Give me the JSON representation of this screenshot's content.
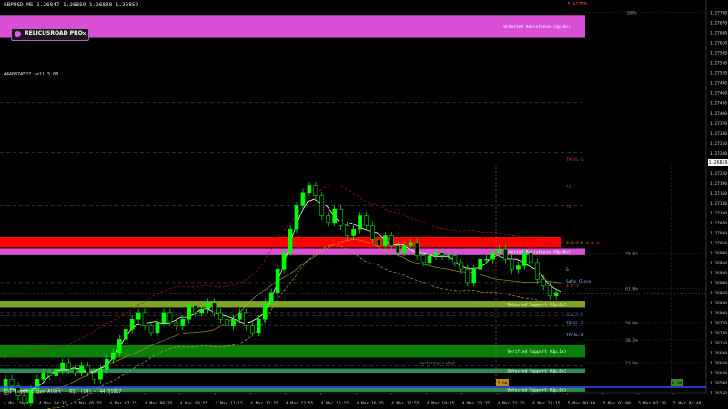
{
  "header": {
    "symbol_line": "GBPUSD,M5  1.26847 1.26859 1.26838 1.26859",
    "badge_label": "RELICUSROAD PRO",
    "badge_close": "✕",
    "trade_info": "#440874527 sell 5.00",
    "rsi_status": "RSI level cross Alert - RSI (14) - 44.51017",
    "top_right_label": "ELASTEM"
  },
  "colors": {
    "background": "#000000",
    "candle": "#00ff00",
    "resistance_zone": "#d94fd6",
    "red_zone": "#ff0000",
    "support_zone": "#7fa528",
    "verified_support": "#0a7f0a",
    "untested_support": "#2e8b57",
    "ma_white": "#ffffff",
    "ma_gold": "#b8a020",
    "ma_red": "#a01818"
  },
  "chart_data": {
    "type": "candlestick",
    "symbol": "GBPUSD",
    "timeframe": "M5",
    "ylim": [
      1.2656,
      1.2771
    ],
    "y_ticks": [
      "1.27700",
      "1.27670",
      "1.27640",
      "1.27610",
      "1.27580",
      "1.27550",
      "1.27520",
      "1.27490",
      "1.27460",
      "1.27430",
      "1.27400",
      "1.27370",
      "1.27340",
      "1.27310",
      "1.27280",
      "1.27250",
      "1.27220",
      "1.27190",
      "1.27160",
      "1.27130",
      "1.27100",
      "1.27070",
      "1.27040",
      "1.27010",
      "1.26980",
      "1.26950",
      "1.26920",
      "1.26890",
      "1.26860",
      "1.26830",
      "1.26800",
      "1.26770",
      "1.26740",
      "1.26710",
      "1.26680",
      "1.26650",
      "1.26620",
      "1.26590",
      "1.26560"
    ],
    "x_ticks": [
      "4 Mar 2024",
      "4 Mar 04:35",
      "4 Mar 05:55",
      "4 Mar 07:15",
      "4 Mar 08:35",
      "4 Mar 09:55",
      "4 Mar 11:15",
      "4 Mar 12:35",
      "4 Mar 13:55",
      "4 Mar 15:15",
      "4 Mar 16:35",
      "4 Mar 17:55",
      "4 Mar 19:15",
      "4 Mar 20:35",
      "4 Mar 21:55",
      "4 Mar 23:15",
      "5 Mar 00:40",
      "5 Mar 02:00",
      "5 Mar 03:20",
      "5 Mar 04:40"
    ],
    "current_price": "1.26859",
    "price_path": [
      1.2657,
      1.266,
      1.2658,
      1.2655,
      1.2653,
      1.2657,
      1.266,
      1.2662,
      1.2661,
      1.2663,
      1.2665,
      1.2663,
      1.2662,
      1.2664,
      1.2662,
      1.266,
      1.2663,
      1.2666,
      1.2668,
      1.2672,
      1.2675,
      1.2678,
      1.268,
      1.2676,
      1.2674,
      1.2677,
      1.268,
      1.2677,
      1.2676,
      1.2678,
      1.2682,
      1.268,
      1.2681,
      1.2683,
      1.268,
      1.2678,
      1.2676,
      1.2678,
      1.268,
      1.2676,
      1.2674,
      1.2678,
      1.2683,
      1.2686,
      1.2693,
      1.2698,
      1.2705,
      1.2712,
      1.2716,
      1.2718,
      1.2715,
      1.2709,
      1.2707,
      1.2711,
      1.2706,
      1.2703,
      1.2705,
      1.2709,
      1.2706,
      1.2702,
      1.27,
      1.2703,
      1.27,
      1.2698,
      1.27,
      1.2701,
      1.2697,
      1.2695,
      1.2697,
      1.2698,
      1.2697,
      1.2697,
      1.2695,
      1.2693,
      1.2689,
      1.2693,
      1.2696,
      1.2696,
      1.2698,
      1.2699,
      1.2696,
      1.2693,
      1.2694,
      1.2698,
      1.2695,
      1.269,
      1.2688,
      1.2685,
      1.2686
    ],
    "zones": [
      {
        "label": "Untested Resistance (Up,0x)",
        "from": 1.2769,
        "to": 1.27624,
        "kind": "resistance"
      },
      {
        "label": "",
        "from": 1.27026,
        "to": 1.26995,
        "kind": "red"
      },
      {
        "label": "Untested Resistance (Up,0x)",
        "from": 1.26992,
        "to": 1.26972,
        "kind": "resistance"
      },
      {
        "label": "Untested Support (Up,0x)",
        "from": 1.26835,
        "to": 1.26815,
        "kind": "support"
      },
      {
        "label": "Verified Support (Up,1x)",
        "from": 1.26702,
        "to": 1.26665,
        "kind": "verified"
      },
      {
        "label": "Untested Support (Up,0x)",
        "from": 1.26632,
        "to": 1.2662,
        "kind": "untested"
      },
      {
        "label": "Untested Support (Up,0x)",
        "from": 1.26574,
        "to": 1.26563,
        "kind": "untested"
      }
    ],
    "fib_levels": [
      {
        "label": "100%",
        "price": 1.277
      },
      {
        "label": "78.6%",
        "price": 1.26978
      },
      {
        "label": "61.8%",
        "price": 1.26872
      },
      {
        "label": "50.0%",
        "price": 1.2677
      },
      {
        "label": "38.2%",
        "price": 1.26718
      },
      {
        "label": "23.6%",
        "price": 1.2665
      }
    ],
    "right_labels": [
      {
        "text": "TP/SL-1",
        "price": 1.2726,
        "color": "#c84040"
      },
      {
        "text": "+3",
        "price": 1.2718,
        "color": "#ff4040"
      },
      {
        "text": "+2",
        "price": 1.2712,
        "color": "#ff4040"
      },
      {
        "text": "8 8 8 8 8 4 4",
        "price": 1.2701,
        "color": "#ff4040"
      },
      {
        "text": "6",
        "price": 1.2693,
        "color": "#bbbbbb"
      },
      {
        "text": "Safe Close",
        "price": 1.26895,
        "color": "#8fb0ff"
      },
      {
        "text": "4 7 7",
        "price": 1.2688,
        "color": "#ff4040"
      },
      {
        "text": "6 6 7 7",
        "price": 1.26795,
        "color": "#4060ff"
      },
      {
        "text": "TP/SL-2",
        "price": 1.2677,
        "color": "#8fb0ff"
      },
      {
        "text": "TP/SL-3",
        "price": 1.26735,
        "color": "#8fb0ff"
      }
    ],
    "session_label": "Yesterday's High",
    "bottom_label_1": "5.00",
    "bottom_label_2": "0.00"
  }
}
